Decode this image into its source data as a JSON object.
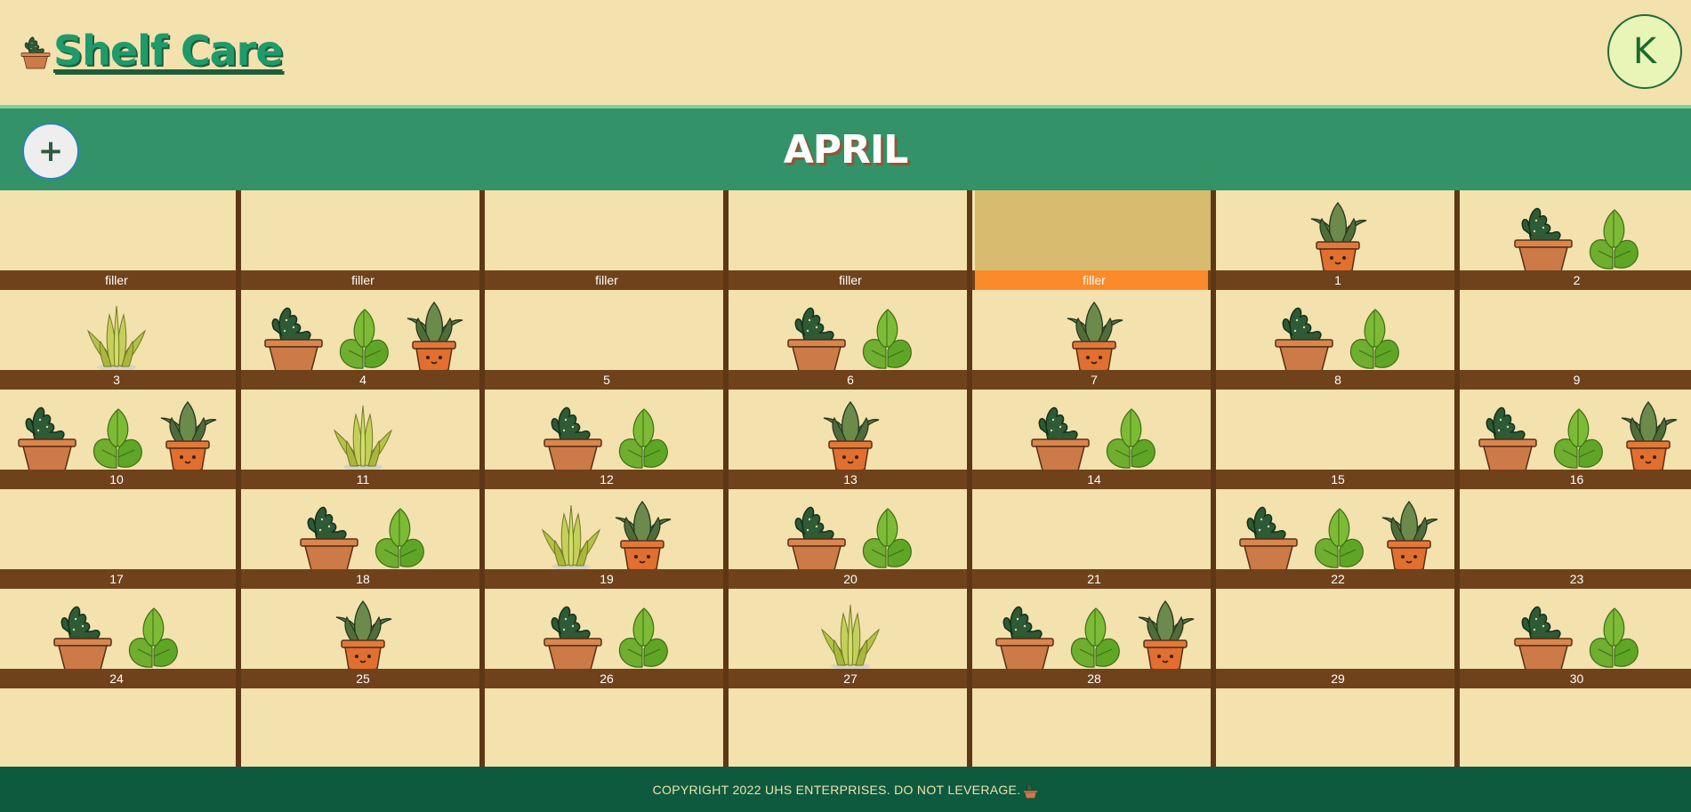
{
  "app": {
    "title": "Shelf Care",
    "logo_icon": "potted-cactus-icon",
    "user_initial": "K"
  },
  "calendar": {
    "month": "APRIL",
    "add_label": "+",
    "today_label": "filler",
    "rows": [
      [
        {
          "label": "filler",
          "plants": []
        },
        {
          "label": "filler",
          "plants": []
        },
        {
          "label": "filler",
          "plants": []
        },
        {
          "label": "filler",
          "plants": []
        },
        {
          "label": "filler",
          "plants": [],
          "highlight": true
        },
        {
          "label": "1",
          "plants": [
            "snake"
          ]
        },
        {
          "label": "2",
          "plants": [
            "cactus",
            "basil"
          ]
        }
      ],
      [
        {
          "label": "3",
          "plants": [
            "aloe"
          ]
        },
        {
          "label": "4",
          "plants": [
            "cactus",
            "basil",
            "snake"
          ]
        },
        {
          "label": "5",
          "plants": []
        },
        {
          "label": "6",
          "plants": [
            "cactus",
            "basil"
          ]
        },
        {
          "label": "7",
          "plants": [
            "snake"
          ]
        },
        {
          "label": "8",
          "plants": [
            "cactus",
            "basil"
          ]
        },
        {
          "label": "9",
          "plants": []
        }
      ],
      [
        {
          "label": "10",
          "plants": [
            "cactus",
            "basil",
            "snake"
          ]
        },
        {
          "label": "11",
          "plants": [
            "aloe"
          ]
        },
        {
          "label": "12",
          "plants": [
            "cactus",
            "basil"
          ]
        },
        {
          "label": "13",
          "plants": [
            "snake"
          ]
        },
        {
          "label": "14",
          "plants": [
            "cactus",
            "basil"
          ]
        },
        {
          "label": "15",
          "plants": []
        },
        {
          "label": "16",
          "plants": [
            "cactus",
            "basil",
            "snake"
          ]
        }
      ],
      [
        {
          "label": "17",
          "plants": []
        },
        {
          "label": "18",
          "plants": [
            "cactus",
            "basil"
          ]
        },
        {
          "label": "19",
          "plants": [
            "aloe",
            "snake"
          ]
        },
        {
          "label": "20",
          "plants": [
            "cactus",
            "basil"
          ]
        },
        {
          "label": "21",
          "plants": []
        },
        {
          "label": "22",
          "plants": [
            "cactus",
            "basil",
            "snake"
          ]
        },
        {
          "label": "23",
          "plants": []
        }
      ],
      [
        {
          "label": "24",
          "plants": [
            "cactus",
            "basil"
          ]
        },
        {
          "label": "25",
          "plants": [
            "snake"
          ]
        },
        {
          "label": "26",
          "plants": [
            "cactus",
            "basil"
          ]
        },
        {
          "label": "27",
          "plants": [
            "aloe"
          ]
        },
        {
          "label": "28",
          "plants": [
            "cactus",
            "basil",
            "snake"
          ]
        },
        {
          "label": "29",
          "plants": []
        },
        {
          "label": "30",
          "plants": [
            "cactus",
            "basil"
          ]
        }
      ]
    ]
  },
  "plant_icons": {
    "cactus": "potted-cactus-icon",
    "basil": "basil-leaves-icon",
    "snake": "potted-snake-plant-icon",
    "aloe": "aloe-plant-icon"
  },
  "footer": {
    "text": "COPYRIGHT 2022 UHS ENTERPRISES. DO NOT LEVERAGE.",
    "icon": "potted-cactus-icon"
  },
  "colors": {
    "background": "#f3e1ae",
    "month_bar": "#339267",
    "shelf": "#6f421b",
    "today_shelf": "#fb8a2b",
    "footer": "#0d5a3f"
  }
}
